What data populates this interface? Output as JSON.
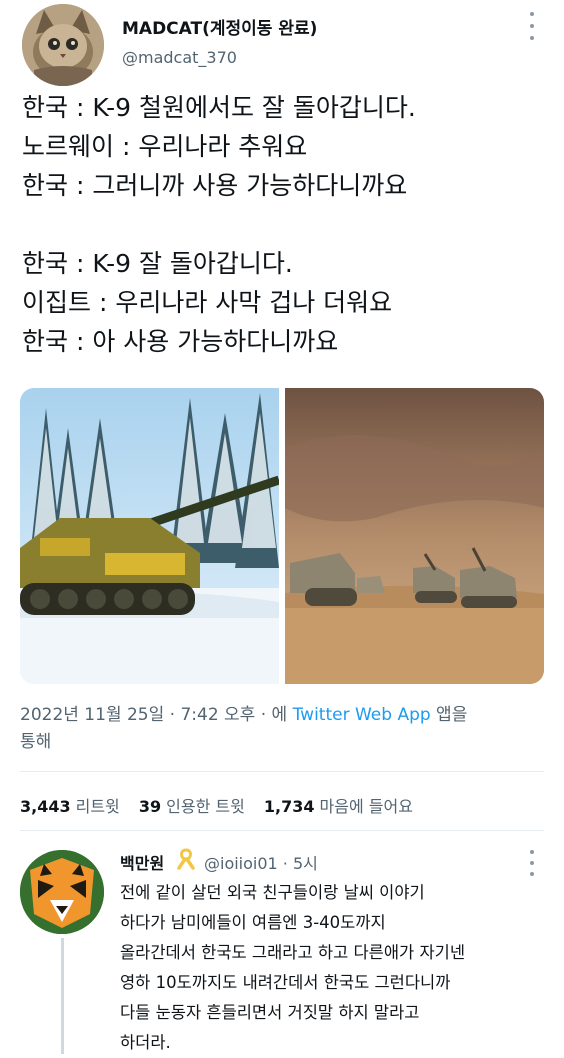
{
  "author": {
    "display_name": "MADCAT(계정이동 완료)",
    "handle": "@madcat_370"
  },
  "tweet": {
    "lines": [
      "한국 : K-9 철원에서도 잘 돌아갑니다.",
      "노르웨이 : 우리나라 추워요",
      "한국 : 그러니까 사용 가능하다니까요",
      "",
      "한국 : K-9 잘 돌아갑니다.",
      "이집트 : 우리나라 사막 겁나 더워요",
      "한국 : 아 사용 가능하다니까요"
    ]
  },
  "media": {
    "left_icon": "snowy-forest-howitzer-photo",
    "right_icon": "desert-howitzers-photo"
  },
  "meta": {
    "timestamp": "2022년 11월 25일 · 7:42 오후 · ",
    "via_prefix": "에 ",
    "source": "Twitter Web App",
    "suffix_1": " 앱을",
    "suffix_2": "통해"
  },
  "stats": {
    "retweets_count": "3,443",
    "retweets_label": "리트윗",
    "quotes_count": "39",
    "quotes_label": "인용한 트윗",
    "likes_count": "1,734",
    "likes_label": "마음에 들어요"
  },
  "reply": {
    "display_name": "백만원",
    "handle_time": "@ioiioi01 · 5시",
    "lines": [
      "전에 같이 살던 외국 친구들이랑 날씨 이야기",
      "하다가 남미에들이 여름엔 3-40도까지",
      "올라간데서 한국도 그래라고 하고 다른애가 자기넨",
      "영하 10도까지도 내려간데서 한국도 그런다니까",
      "다들 눈동자 흔들리면서 거짓말 하지 말라고",
      "하더라."
    ]
  },
  "colors": {
    "link_blue": "#1d9bf0",
    "secondary_text": "#536471",
    "ribbon_yellow": "#f2c744"
  }
}
